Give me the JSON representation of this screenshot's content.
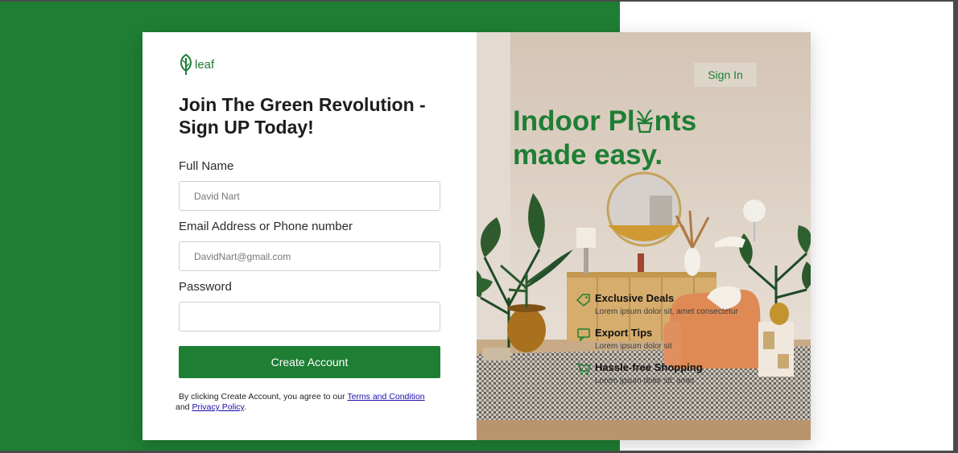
{
  "brand": {
    "logo_text": "leaf",
    "logo_icon": "leaf-icon"
  },
  "signup": {
    "heading": "Join The Green Revolution - Sign UP Today!",
    "full_name_label": "Full Name",
    "full_name_placeholder": "David Nart",
    "email_label": "Email Address or Phone number",
    "email_placeholder": "DavidNart@gmail.com",
    "password_label": "Password",
    "password_placeholder": "",
    "create_button": "Create Account",
    "terms_prefix": "By clicking Create Account, you agree to our ",
    "terms_link": "Terms and Condition",
    "terms_middle": " and ",
    "privacy_link": "Privacy Policy",
    "terms_suffix": "."
  },
  "hero": {
    "signin_button": "Sign In",
    "title_part1": "Indoor Pl",
    "title_part2": "nts",
    "title_line2": "made easy.",
    "title_glyph_icon": "potted-plant-icon"
  },
  "features": [
    {
      "icon": "tag-icon",
      "title": "Exclusive Deals",
      "desc": "Lorem ipsum dolor sit, amet consectetur"
    },
    {
      "icon": "chat-icon",
      "title": "Export Tips",
      "desc": "Lorem ipsum dolor sit"
    },
    {
      "icon": "cart-icon",
      "title": "Hassle-free Shopping",
      "desc": "Lorem ipsum dolor sit, amet"
    }
  ],
  "colors": {
    "brand_green": "#1e7e34",
    "panel_white": "#ffffff"
  }
}
